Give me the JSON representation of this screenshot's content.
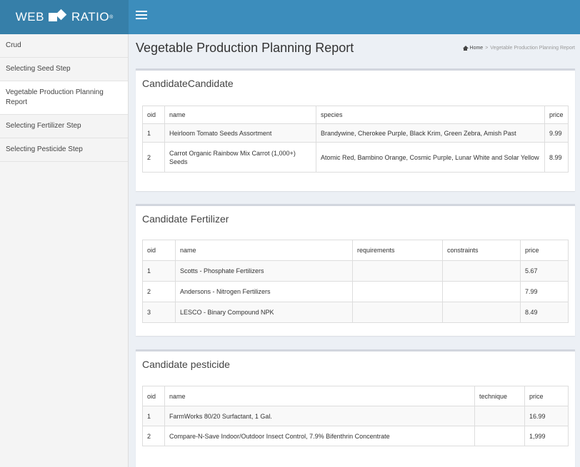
{
  "logo": {
    "left": "WEB",
    "right": "RATIO",
    "reg": "®"
  },
  "sidebar": {
    "items": [
      {
        "label": "Crud"
      },
      {
        "label": "Selecting Seed Step"
      },
      {
        "label": "Vegetable Production Planning Report"
      },
      {
        "label": "Selecting Fertilizer Step"
      },
      {
        "label": "Selecting Pesticide Step"
      }
    ]
  },
  "page": {
    "title": "Vegetable Production Planning Report",
    "breadcrumb": {
      "home": "Home",
      "separator": ">",
      "current": "Vegetable Production Planning Report"
    }
  },
  "seeds": {
    "title": "CandidateCandidate",
    "headers": [
      "oid",
      "name",
      "species",
      "price"
    ],
    "rows": [
      [
        "1",
        "Heirloom Tomato Seeds Assortment",
        "Brandywine, Cherokee Purple, Black Krim, Green Zebra, Amish Past",
        "9.99"
      ],
      [
        "2",
        "Carrot Organic Rainbow Mix Carrot (1,000+) Seeds",
        "Atomic Red, Bambino Orange, Cosmic Purple, Lunar White and Solar Yellow",
        "8.99"
      ]
    ]
  },
  "fertilizer": {
    "title": "Candidate Fertilizer",
    "headers": [
      "oid",
      "name",
      "requirements",
      "constraints",
      "price"
    ],
    "rows": [
      [
        "1",
        "Scotts - Phosphate Fertilizers",
        "",
        "",
        "5.67"
      ],
      [
        "2",
        "Andersons - Nitrogen Fertilizers",
        "",
        "",
        "7.99"
      ],
      [
        "3",
        "LESCO - Binary Compound NPK",
        "",
        "",
        "8.49"
      ]
    ]
  },
  "pesticide": {
    "title": "Candidate pesticide",
    "headers": [
      "oid",
      "name",
      "technique",
      "price"
    ],
    "rows": [
      [
        "1",
        "FarmWorks 80/20 Surfactant, 1 Gal.",
        "",
        "16.99"
      ],
      [
        "2",
        "Compare-N-Save Indoor/Outdoor Insect Control, 7.9% Bifenthrin Concentrate",
        "",
        "1,999"
      ]
    ]
  }
}
